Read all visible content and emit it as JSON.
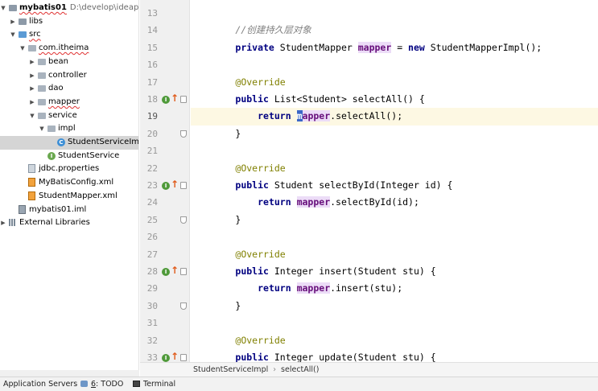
{
  "project_tree": [
    {
      "label": "mybatis01",
      "path": "D:\\develop\\ideaproject",
      "icon": "folder-icon",
      "arrow": "down",
      "depth": 0,
      "bold": true,
      "wavy": true
    },
    {
      "label": "libs",
      "icon": "folder-icon",
      "arrow": "right",
      "depth": 1
    },
    {
      "label": "src",
      "icon": "source-folder-icon",
      "arrow": "down",
      "depth": 1,
      "wavy": true
    },
    {
      "label": "com.itheima",
      "icon": "package-icon",
      "arrow": "down",
      "depth": 2,
      "wavy": true
    },
    {
      "label": "bean",
      "icon": "package-icon",
      "arrow": "right",
      "depth": 3
    },
    {
      "label": "controller",
      "icon": "package-icon",
      "arrow": "right",
      "depth": 3
    },
    {
      "label": "dao",
      "icon": "package-icon",
      "arrow": "right",
      "depth": 3
    },
    {
      "label": "mapper",
      "icon": "package-icon",
      "arrow": "right",
      "depth": 3,
      "wavy": true
    },
    {
      "label": "service",
      "icon": "package-icon",
      "arrow": "down",
      "depth": 3
    },
    {
      "label": "impl",
      "icon": "package-icon",
      "arrow": "down",
      "depth": 4
    },
    {
      "label": "StudentServiceImp",
      "icon": "class-icon",
      "depth": 5,
      "selected": true
    },
    {
      "label": "StudentService",
      "icon": "interface-icon",
      "depth": 4
    },
    {
      "label": "jdbc.properties",
      "icon": "properties-file-icon",
      "depth": 2
    },
    {
      "label": "MyBatisConfig.xml",
      "icon": "xml-file-icon",
      "depth": 2
    },
    {
      "label": "StudentMapper.xml",
      "icon": "xml-file-icon",
      "depth": 2
    },
    {
      "label": "mybatis01.iml",
      "icon": "iml-file-icon",
      "depth": 1
    },
    {
      "label": "External Libraries",
      "icon": "library-icon",
      "arrow": "right",
      "depth": 0
    }
  ],
  "editor": {
    "current_line": 19,
    "lines": [
      {
        "n": "13",
        "tokens": []
      },
      {
        "n": "14",
        "tokens": [
          {
            "t": "        "
          },
          {
            "t": "//创建持久层对象",
            "c": "com"
          }
        ]
      },
      {
        "n": "15",
        "tokens": [
          {
            "t": "        "
          },
          {
            "t": "private",
            "c": "kw"
          },
          {
            "t": " StudentMapper "
          },
          {
            "t": "mapper",
            "c": "field"
          },
          {
            "t": " = "
          },
          {
            "t": "new",
            "c": "kw"
          },
          {
            "t": " StudentMapperImpl();"
          }
        ]
      },
      {
        "n": "16",
        "tokens": []
      },
      {
        "n": "17",
        "tokens": [
          {
            "t": "        "
          },
          {
            "t": "@Override",
            "c": "ann"
          }
        ]
      },
      {
        "n": "18",
        "tokens": [
          {
            "t": "        "
          },
          {
            "t": "public",
            "c": "kw"
          },
          {
            "t": " List<Student> selectAll() {"
          }
        ],
        "gutter": "impl-up",
        "fold": "start"
      },
      {
        "n": "19",
        "tokens": [
          {
            "t": "            "
          },
          {
            "t": "return",
            "c": "kw"
          },
          {
            "t": " "
          },
          {
            "t": "m",
            "c": "caret"
          },
          {
            "t": "apper",
            "c": "field"
          },
          {
            "t": ".selectAll();"
          }
        ]
      },
      {
        "n": "20",
        "tokens": [
          {
            "t": "        }"
          }
        ],
        "fold": "end"
      },
      {
        "n": "21",
        "tokens": []
      },
      {
        "n": "22",
        "tokens": [
          {
            "t": "        "
          },
          {
            "t": "@Override",
            "c": "ann"
          }
        ]
      },
      {
        "n": "23",
        "tokens": [
          {
            "t": "        "
          },
          {
            "t": "public",
            "c": "kw"
          },
          {
            "t": " Student selectById(Integer id) {"
          }
        ],
        "gutter": "impl-up",
        "fold": "start"
      },
      {
        "n": "24",
        "tokens": [
          {
            "t": "            "
          },
          {
            "t": "return",
            "c": "kw"
          },
          {
            "t": " "
          },
          {
            "t": "mapper",
            "c": "field"
          },
          {
            "t": ".selectById(id);"
          }
        ]
      },
      {
        "n": "25",
        "tokens": [
          {
            "t": "        }"
          }
        ],
        "fold": "end"
      },
      {
        "n": "26",
        "tokens": []
      },
      {
        "n": "27",
        "tokens": [
          {
            "t": "        "
          },
          {
            "t": "@Override",
            "c": "ann"
          }
        ]
      },
      {
        "n": "28",
        "tokens": [
          {
            "t": "        "
          },
          {
            "t": "public",
            "c": "kw"
          },
          {
            "t": " Integer insert(Student stu) {"
          }
        ],
        "gutter": "impl-up",
        "fold": "start"
      },
      {
        "n": "29",
        "tokens": [
          {
            "t": "            "
          },
          {
            "t": "return",
            "c": "kw"
          },
          {
            "t": " "
          },
          {
            "t": "mapper",
            "c": "field"
          },
          {
            "t": ".insert(stu);"
          }
        ]
      },
      {
        "n": "30",
        "tokens": [
          {
            "t": "        }"
          }
        ],
        "fold": "end"
      },
      {
        "n": "31",
        "tokens": []
      },
      {
        "n": "32",
        "tokens": [
          {
            "t": "        "
          },
          {
            "t": "@Override",
            "c": "ann"
          }
        ]
      },
      {
        "n": "33",
        "tokens": [
          {
            "t": "        "
          },
          {
            "t": "public",
            "c": "kw"
          },
          {
            "t": " Integer update(Student stu) {"
          }
        ],
        "gutter": "impl-up",
        "fold": "start"
      }
    ]
  },
  "breadcrumb": {
    "class_name": "StudentServiceImpl",
    "method_name": "selectAll()"
  },
  "tool_windows": {
    "app_servers": "Application Servers",
    "todo_prefix": "6",
    "todo_label": ": TODO",
    "terminal": "Terminal"
  },
  "colors": {
    "keyword": "#000080",
    "field": "#660e7a",
    "annotation": "#808000",
    "comment": "#808080",
    "current_line": "#fdf8e3",
    "selection": "#d5d5d5"
  }
}
